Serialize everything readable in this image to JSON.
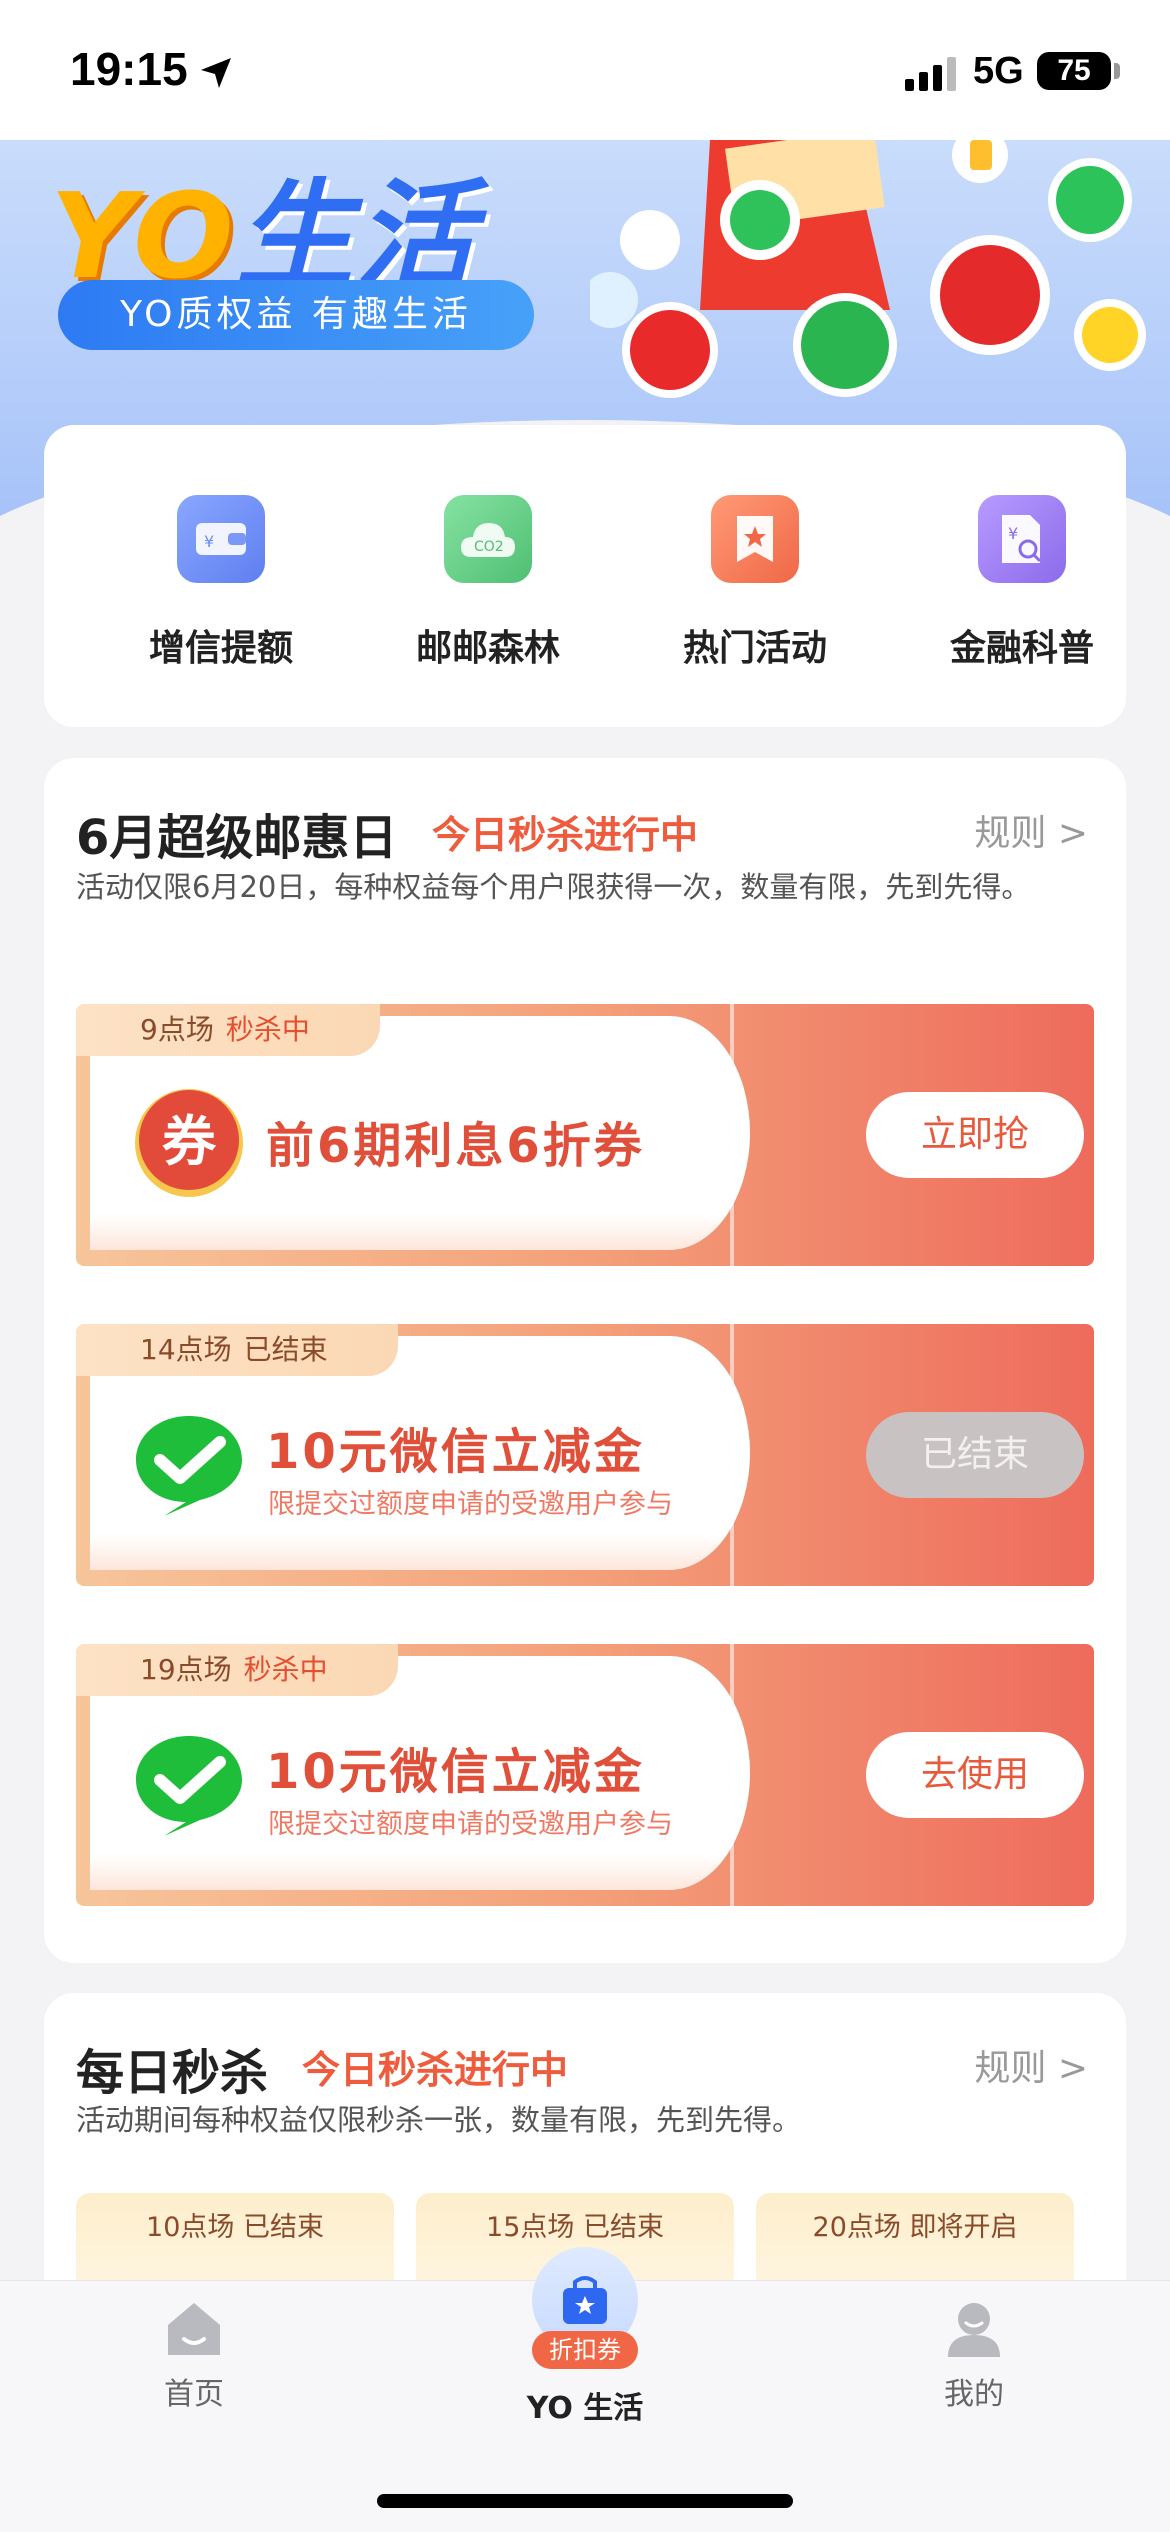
{
  "status_bar": {
    "time": "19:15",
    "network": "5G",
    "battery": "75"
  },
  "hero": {
    "title_left": "YO",
    "title_right": "生活",
    "subtitle": "YO质权益 有趣生活"
  },
  "quick_menu": [
    {
      "label": "增信提额",
      "icon": "wallet-icon",
      "color": "#6f8ff5"
    },
    {
      "label": "邮邮森林",
      "icon": "co2-cloud-icon",
      "color": "#63c783"
    },
    {
      "label": "热门活动",
      "icon": "star-bookmark-icon",
      "color": "#f27a55"
    },
    {
      "label": "金融科普",
      "icon": "finance-doc-icon",
      "color": "#9a78ef"
    }
  ],
  "super_day": {
    "title": "6月超级邮惠日",
    "hot": "今日秒杀进行中",
    "rule": "规则 >",
    "desc": "活动仅限6月20日，每种权益每个用户限获得一次，数量有限，先到先得。",
    "coupons": [
      {
        "slot": "9点场",
        "state": "秒杀中",
        "name": "前6期利息6折券",
        "note": "",
        "button": "立即抢",
        "icon": "coupon-icon",
        "disabled": false
      },
      {
        "slot": "14点场",
        "state": "已结束",
        "name": "10元微信立减金",
        "note": "限提交过额度申请的受邀用户参与",
        "button": "已结束",
        "icon": "wechat-icon",
        "disabled": true
      },
      {
        "slot": "19点场",
        "state": "秒杀中",
        "name": "10元微信立减金",
        "note": "限提交过额度申请的受邀用户参与",
        "button": "去使用",
        "icon": "wechat-icon",
        "disabled": false
      }
    ]
  },
  "daily": {
    "title": "每日秒杀",
    "hot": "今日秒杀进行中",
    "rule": "规则 >",
    "desc": "活动期间每种权益仅限秒杀一张，数量有限，先到先得。",
    "slots": [
      "10点场 已结束",
      "15点场 已结束",
      "20点场 即将开启"
    ]
  },
  "tabbar": {
    "home": "首页",
    "center_badge": "折扣券",
    "center": "YO 生活",
    "mine": "我的"
  }
}
